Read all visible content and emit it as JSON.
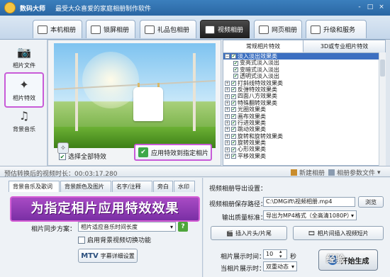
{
  "app": {
    "name": "数码大师",
    "slogan": "最受大众喜爱的家庭相册制作软件",
    "window_controls": [
      "-",
      "□",
      "×"
    ]
  },
  "top_tabs": [
    {
      "label": "本机相册",
      "icon": "album-icon"
    },
    {
      "label": "锁屏相册",
      "icon": "lock-screen-icon"
    },
    {
      "label": "礼品包相册",
      "icon": "gift-icon"
    },
    {
      "label": "视频相册",
      "icon": "video-icon",
      "active": true
    },
    {
      "label": "网页相册",
      "icon": "webpage-icon"
    },
    {
      "label": "升级和服务",
      "icon": "upgrade-icon"
    }
  ],
  "sidebar": {
    "items": [
      {
        "label": "相片文件",
        "icon": "camera-icon"
      },
      {
        "label": "相片特效",
        "icon": "sparkle-icon",
        "active": true
      },
      {
        "label": "背景音乐",
        "icon": "music-note-icon"
      }
    ]
  },
  "preview": {
    "select_all_label": "选择全部特效",
    "select_all_checked": true,
    "apply_button_label": "应用特效到指定相片"
  },
  "effects": {
    "tabs": [
      "常规相片特效",
      "3D或专业相片特效"
    ],
    "active_tab": 0,
    "rows": [
      {
        "label": "淡入淡出效果类",
        "level": 0,
        "expanded": true,
        "checked": true,
        "selected": true
      },
      {
        "label": "变亮式淡入淡出",
        "level": 1,
        "checked": true
      },
      {
        "label": "变暗式淡入淡出",
        "level": 1,
        "checked": true
      },
      {
        "label": "透明式淡入淡出",
        "level": 1,
        "checked": true
      },
      {
        "label": "打斜线特效效果类",
        "level": 0,
        "checked": true
      },
      {
        "label": "反弹特效效果类",
        "level": 0,
        "checked": true
      },
      {
        "label": "四面八方效果类",
        "level": 0,
        "checked": true
      },
      {
        "label": "特殊翻转效果类",
        "level": 0,
        "checked": true
      },
      {
        "label": "光圈效果类",
        "level": 0,
        "checked": true
      },
      {
        "label": "画布效果类",
        "level": 0,
        "checked": true
      },
      {
        "label": "行进效果类",
        "level": 0,
        "checked": true
      },
      {
        "label": "跳动效果类",
        "level": 0,
        "checked": true
      },
      {
        "label": "旋转和旋转效果类",
        "level": 0,
        "checked": true
      },
      {
        "label": "旋转效果类",
        "level": 0,
        "checked": true
      },
      {
        "label": "心形效果类",
        "level": 0,
        "checked": true
      },
      {
        "label": "平移效果类",
        "level": 0,
        "checked": true
      }
    ]
  },
  "duration_bar": {
    "text": "预估转换后的视频时长：00:03:17.280",
    "new_album_label": "新建相册",
    "album_params_label": "相册参数文件"
  },
  "bottom_left": {
    "tabs": [
      "背景音乐及歌词",
      "背景颜色及图片",
      "名字/注释",
      "旁白",
      "水印"
    ],
    "active_tab": 0,
    "banner_text": "为指定相片应用特效效果",
    "sync_label": "相片同步方案：",
    "sync_value": "相片适应音乐时间长度",
    "bg_switch_label": "启用背景视频切换功能",
    "mtv_button_label": "字幕详细设置",
    "mtv_badge": "MTV"
  },
  "bottom_right": {
    "export_title": "视频相册导出设置：",
    "save_path_label": "视频相册保存路径：",
    "save_path_value": "C:\\DMGift\\视频相册.mp4",
    "browse_label": "浏览",
    "quality_label": "输出质量标准：",
    "quality_value": "导出为MP4格式（全高清1080P）",
    "insert_intro_label": "插入片头/片尾",
    "insert_video_label": "相片间插入视频短片",
    "display_time_label": "相片展示时间：",
    "display_time_value": "10",
    "seconds_unit": "秒",
    "display_mode_label": "当相片展示时：",
    "display_mode_value": "双重动态",
    "start_label": "开始生成"
  },
  "watermark_text": "经验"
}
